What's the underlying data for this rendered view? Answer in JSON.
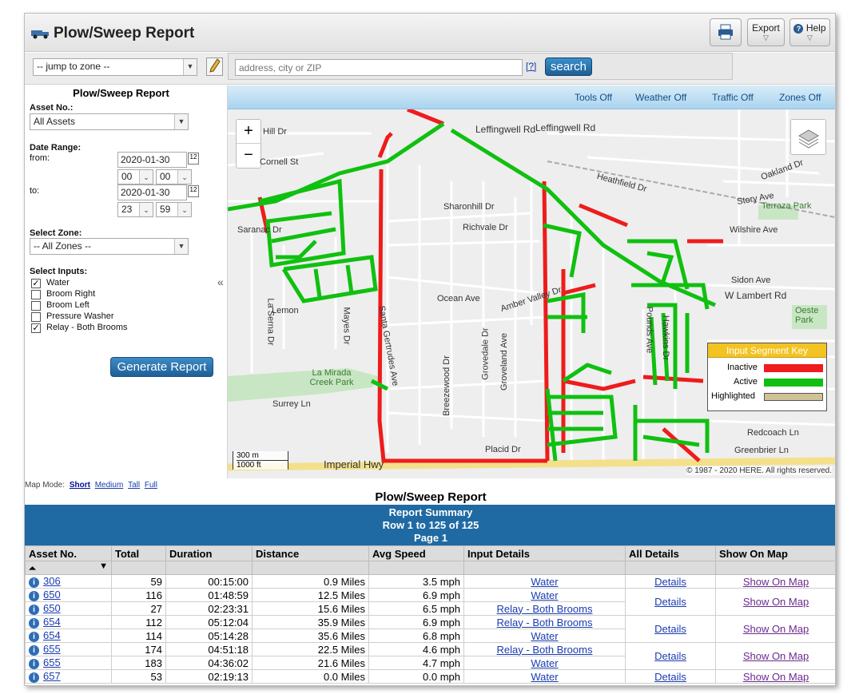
{
  "header": {
    "title": "Plow/Sweep Report",
    "export_label": "Export",
    "help_label": "Help"
  },
  "toolbar": {
    "zone_select": "-- jump to zone --",
    "address_placeholder": "address, city or ZIP",
    "help_link": "[?]",
    "search_label": "search"
  },
  "sidebar": {
    "title": "Plow/Sweep Report",
    "asset_label": "Asset No.:",
    "asset_value": "All Assets",
    "date_range_label": "Date Range:",
    "from_label": "from:",
    "from_date": "2020-01-30",
    "from_hour": "00",
    "from_min": "00",
    "to_label": "to:",
    "to_date": "2020-01-30",
    "to_hour": "23",
    "to_min": "59",
    "zone_label": "Select Zone:",
    "zone_value": "-- All Zones --",
    "inputs_label": "Select Inputs:",
    "inputs": [
      {
        "label": "Water",
        "checked": true
      },
      {
        "label": "Broom Right",
        "checked": false
      },
      {
        "label": "Broom Left",
        "checked": false
      },
      {
        "label": "Pressure Washer",
        "checked": false
      },
      {
        "label": "Relay - Both Brooms",
        "checked": true
      }
    ],
    "generate_label": "Generate Report"
  },
  "map": {
    "controls": {
      "tools": "Tools Off",
      "weather": "Weather Off",
      "traffic": "Traffic Off",
      "zones": "Zones Off"
    },
    "zoom_in": "+",
    "zoom_out": "−",
    "legend": {
      "title": "Input Segment Key",
      "inactive": "Inactive",
      "active": "Active",
      "highlighted": "Highlighted",
      "inactive_color": "#ee1c1c",
      "active_color": "#10c010",
      "highlighted_color": "#cfc295"
    },
    "scale": {
      "metric": "300 m",
      "imperial": "1000 ft"
    },
    "copyright": "© 1987 - 2020 HERE. All rights reserved.",
    "streets": [
      "Leffingwell Rd",
      "Leffingwell Rd",
      "Heathfield Dr",
      "Story Ave",
      "Oakland Dr",
      "Terraza Park",
      "Wilshire Ave",
      "Sharonhill Dr",
      "Richvale Dr",
      "Ocean Ave",
      "Amber Valley Dr",
      "Sidon Ave",
      "W Lambert Rd",
      "Oeste Park",
      "La Serna Dr",
      "Mayes Dr",
      "Lemon",
      "Santa Gertrudes Ave",
      "La Mirada Creek Park",
      "Surrey Ln",
      "Breezewood Dr",
      "Grovedale Dr",
      "Groveland Ave",
      "Placid Dr",
      "Imperial Hwy",
      "Redcoach Ln",
      "Greenbrier Ln",
      "Saranac Dr",
      "Cornell St",
      "Hill Dr",
      "Pounds Ave",
      "Hawkins Dr"
    ]
  },
  "mapmode": {
    "label": "Map Mode:",
    "short": "Short",
    "medium": "Medium",
    "tall": "Tall",
    "full": "Full"
  },
  "report": {
    "title": "Plow/Sweep Report",
    "summary": "Report Summary",
    "rows_info": "Row 1 to 125 of 125",
    "page": "Page 1",
    "columns": [
      "Asset No.",
      "Total",
      "Duration",
      "Distance",
      "Avg Speed",
      "Input Details",
      "All Details",
      "Show On Map"
    ],
    "rows": [
      {
        "asset": "306",
        "total": "59",
        "duration": "00:15:00",
        "distance": "0.9 Miles",
        "speed": "3.5 mph",
        "input": "Water"
      },
      {
        "asset": "650",
        "total": "116",
        "duration": "01:48:59",
        "distance": "12.5 Miles",
        "speed": "6.9 mph",
        "input": "Water"
      },
      {
        "asset": "650",
        "total": "27",
        "duration": "02:23:31",
        "distance": "15.6 Miles",
        "speed": "6.5 mph",
        "input": "Relay - Both Brooms"
      },
      {
        "asset": "654",
        "total": "112",
        "duration": "05:12:04",
        "distance": "35.9 Miles",
        "speed": "6.9 mph",
        "input": "Relay - Both Brooms"
      },
      {
        "asset": "654",
        "total": "114",
        "duration": "05:14:28",
        "distance": "35.6 Miles",
        "speed": "6.8 mph",
        "input": "Water"
      },
      {
        "asset": "655",
        "total": "174",
        "duration": "04:51:18",
        "distance": "22.5 Miles",
        "speed": "4.6 mph",
        "input": "Relay - Both Brooms"
      },
      {
        "asset": "655",
        "total": "183",
        "duration": "04:36:02",
        "distance": "21.6 Miles",
        "speed": "4.7 mph",
        "input": "Water"
      },
      {
        "asset": "657",
        "total": "53",
        "duration": "02:19:13",
        "distance": "0.0 Miles",
        "speed": "0.0 mph",
        "input": "Water"
      }
    ],
    "details_label": "Details",
    "show_on_map_label": "Show On Map"
  }
}
